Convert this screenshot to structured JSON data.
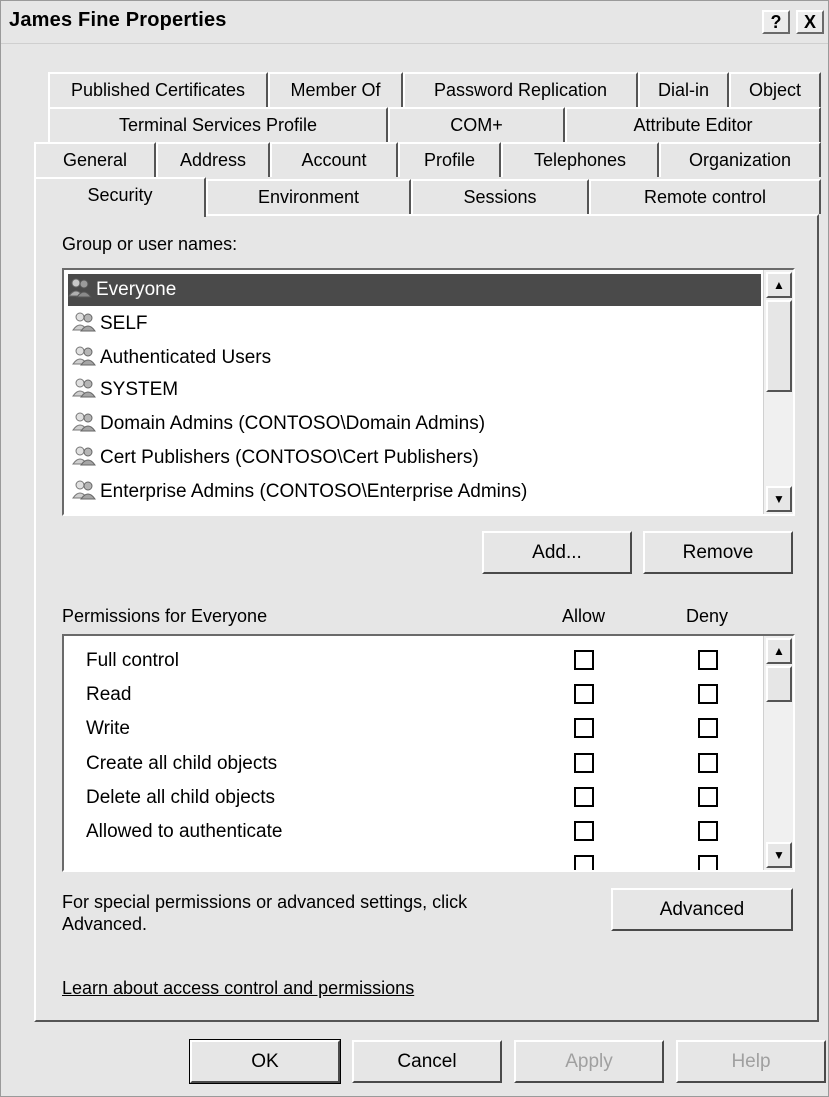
{
  "window": {
    "title": "James Fine Properties",
    "help_btn": "?",
    "close_btn": "X"
  },
  "tabs": {
    "row1": [
      "Published Certificates",
      "Member Of",
      "Password Replication",
      "Dial-in",
      "Object"
    ],
    "row2": [
      "Terminal Services Profile",
      "COM+",
      "Attribute Editor"
    ],
    "row3": [
      "General",
      "Address",
      "Account",
      "Profile",
      "Telephones",
      "Organization"
    ],
    "row4": [
      "Security",
      "Environment",
      "Sessions",
      "Remote control"
    ],
    "active": "Security"
  },
  "security": {
    "group_label": "Group or user names:",
    "users": [
      "Everyone",
      "SELF",
      "Authenticated Users",
      "SYSTEM",
      "Domain Admins (CONTOSO\\Domain Admins)",
      "Cert Publishers (CONTOSO\\Cert Publishers)",
      "Enterprise Admins (CONTOSO\\Enterprise Admins)"
    ],
    "selected_user": "Everyone",
    "add_label": "Add...",
    "remove_label": "Remove",
    "permissions_label": "Permissions for Everyone",
    "allow_header": "Allow",
    "deny_header": "Deny",
    "permissions": [
      "Full control",
      "Read",
      "Write",
      "Create all child objects",
      "Delete all child objects",
      "Allowed to authenticate"
    ],
    "special_text_1": "For special permissions or advanced settings, click",
    "special_text_2": "Advanced.",
    "advanced_label": "Advanced",
    "learn_link": "Learn about access control and permissions"
  },
  "footer": {
    "ok": "OK",
    "cancel": "Cancel",
    "apply": "Apply",
    "help": "Help"
  },
  "icons": {
    "user": "user-group-icon",
    "scroll_up": "scroll-up-arrow-icon",
    "scroll_down": "scroll-down-arrow-icon"
  },
  "colors": {
    "selection": "#4a4a4a",
    "face": "#e6e6e6"
  }
}
